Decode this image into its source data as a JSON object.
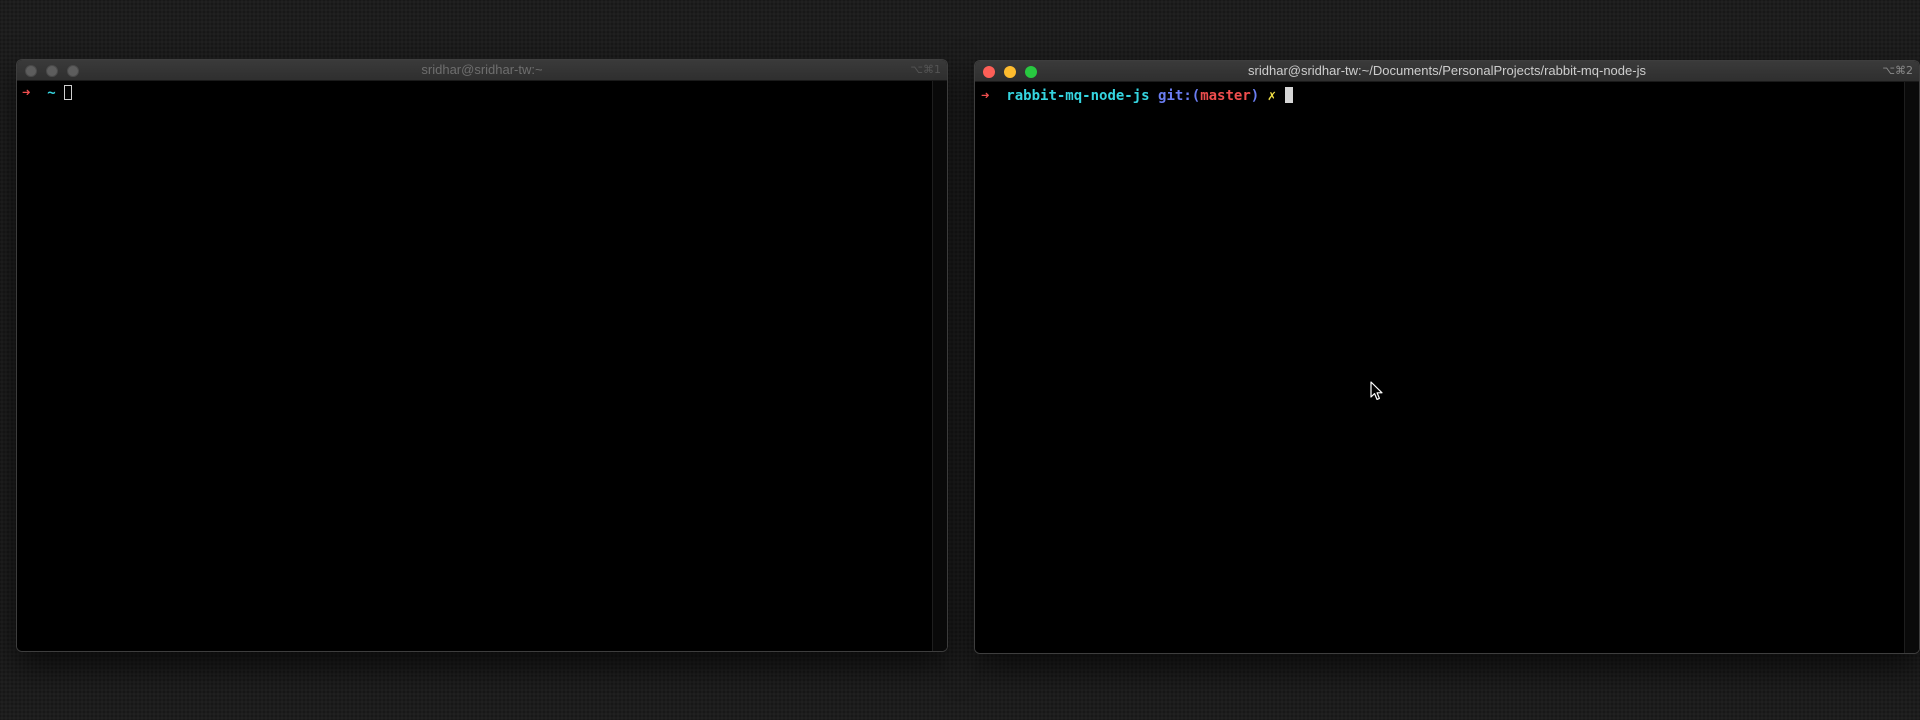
{
  "windows": {
    "left": {
      "title": "sridhar@sridhar-tw:~",
      "shortcut": "⌥⌘1",
      "prompt": {
        "arrow": "➜",
        "cwd": "~"
      }
    },
    "right": {
      "title": "sridhar@sridhar-tw:~/Documents/PersonalProjects/rabbit-mq-node-js",
      "shortcut": "⌥⌘2",
      "prompt": {
        "arrow": "➜",
        "cwd": "rabbit-mq-node-js",
        "git_label": "git:",
        "paren_open": "(",
        "branch": "master",
        "paren_close": ")",
        "dirty_mark": "✗"
      }
    }
  },
  "icons": {
    "cursor": "mouse-pointer-icon"
  },
  "colors": {
    "prompt_arrow": "#ef4e4e",
    "directory": "#35d5e0",
    "git_label": "#6a7df2",
    "branch": "#ef4e4e",
    "dirty_mark": "#f3e146",
    "traffic_close": "#fe5f57",
    "traffic_minimize": "#febc2e",
    "traffic_maximize": "#28c840"
  }
}
